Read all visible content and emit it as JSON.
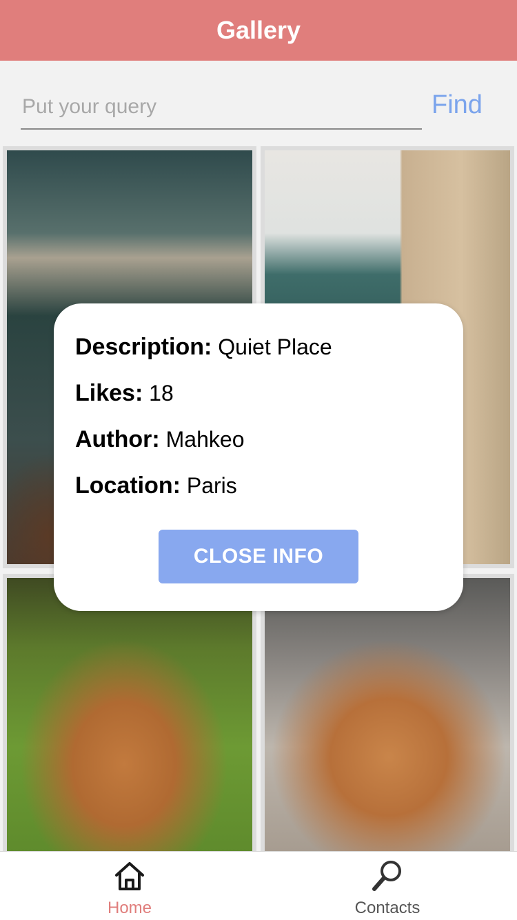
{
  "header": {
    "title": "Gallery"
  },
  "search": {
    "placeholder": "Put your query",
    "value": "",
    "button_label": "Find"
  },
  "info": {
    "description_label": "Description:",
    "description_value": "Quiet Place",
    "likes_label": "Likes:",
    "likes_value": "18",
    "author_label": "Author:",
    "author_value": "Mahkeo",
    "location_label": "Location:",
    "location_value": "Paris",
    "close_label": "CLOSE INFO"
  },
  "tabs": [
    {
      "label": "Home",
      "icon": "home-icon",
      "active": true
    },
    {
      "label": "Contacts",
      "icon": "search-icon",
      "active": false
    }
  ],
  "colors": {
    "header": "#e07e7c",
    "accent": "#7ba4ec",
    "button": "#88a8ef",
    "active_tab": "#e07e7c"
  }
}
